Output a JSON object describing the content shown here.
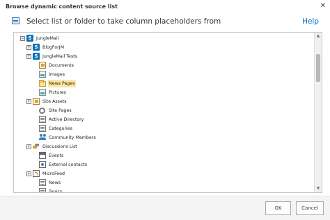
{
  "dialog": {
    "title": "Browse dynamic content source list",
    "close_label": "✕"
  },
  "instruction": "Select list or folder to take column placeholders from",
  "help_label": "Help",
  "tree": {
    "items": [
      {
        "label": "JungleMail",
        "icon": "sharepoint-site-icon",
        "expander": "−",
        "selected": false
      },
      {
        "label": "BlogForJM",
        "icon": "sharepoint-site-icon",
        "expander": "+",
        "selected": false
      },
      {
        "label": "JungleMail Tests",
        "icon": "sharepoint-site-icon",
        "expander": "+",
        "selected": false
      },
      {
        "label": "Documents",
        "icon": "document-library-icon",
        "selected": false
      },
      {
        "label": "Images",
        "icon": "picture-library-icon",
        "selected": false
      },
      {
        "label": "News Pages",
        "icon": "folder-icon",
        "selected": true
      },
      {
        "label": "Pictures",
        "icon": "picture-library-icon",
        "selected": false
      },
      {
        "label": "Site Assets",
        "icon": "document-library-icon",
        "expander": "+",
        "selected": false
      },
      {
        "label": "Site Pages",
        "icon": "gear-icon",
        "selected": false
      },
      {
        "label": "Active Directory",
        "icon": "list-icon",
        "selected": false
      },
      {
        "label": "Categories",
        "icon": "list-icon",
        "selected": false
      },
      {
        "label": "Community Members",
        "icon": "people-icon",
        "selected": false
      },
      {
        "label": "Discussions List",
        "icon": "discussion-icon",
        "expander": "+",
        "selected": false
      },
      {
        "label": "Events",
        "icon": "calendar-icon",
        "selected": false
      },
      {
        "label": "External contacts",
        "icon": "contacts-icon",
        "selected": false
      },
      {
        "label": "MicroFeed",
        "icon": "feed-icon",
        "expander": "+",
        "selected": false
      },
      {
        "label": "News",
        "icon": "list-icon",
        "selected": false
      },
      {
        "label": "Topics",
        "icon": "list-icon",
        "selected": false
      }
    ]
  },
  "buttons": {
    "ok": "OK",
    "cancel": "Cancel"
  },
  "colors": {
    "selection": "#ffe7a3",
    "help_link": "#0072c6",
    "sharepoint_blue": "#0b72b9"
  }
}
